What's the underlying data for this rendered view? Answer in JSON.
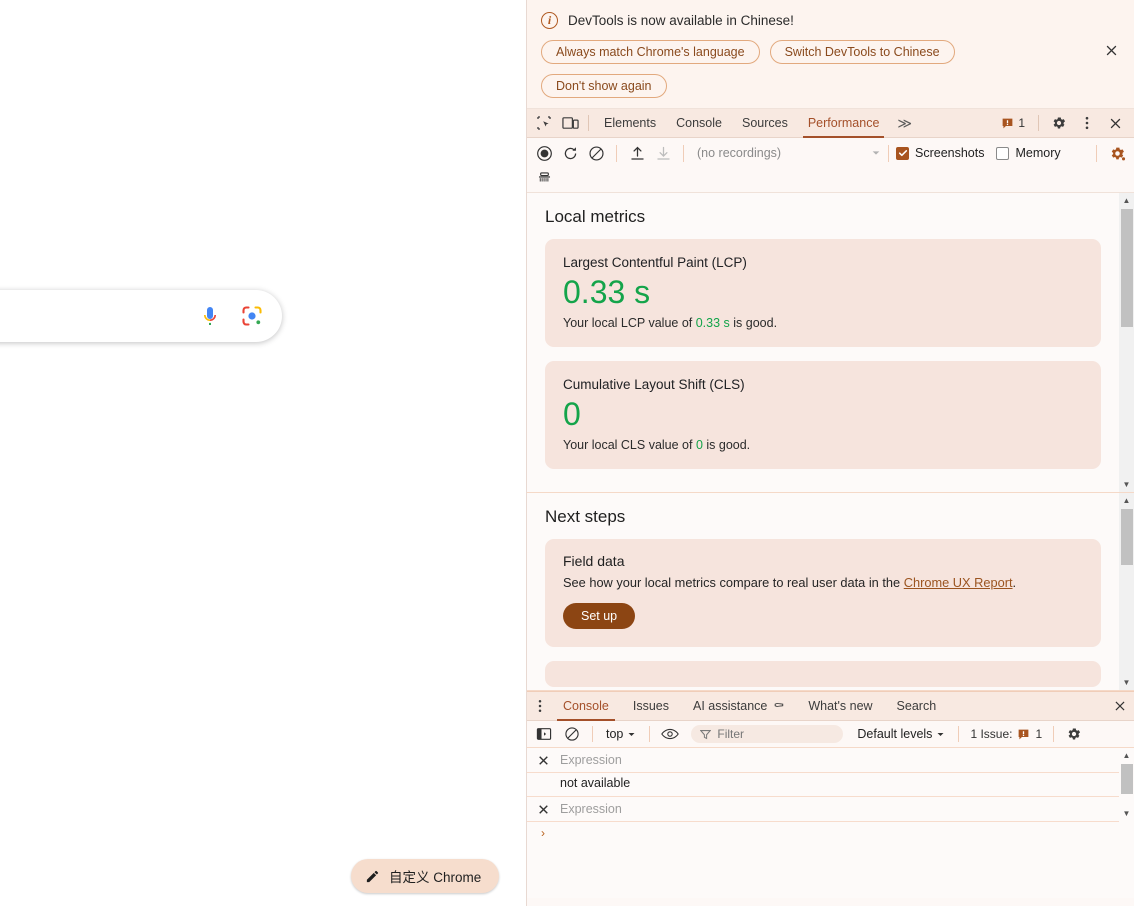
{
  "page": {
    "customize_button": "自定义 Chrome",
    "icons": {
      "pencil": "pencil-icon",
      "mic": "microphone-icon",
      "lens": "google-lens-icon"
    }
  },
  "devtools": {
    "infobar": {
      "message": "DevTools is now available in Chinese!",
      "buttons": [
        "Always match Chrome's language",
        "Switch DevTools to Chinese",
        "Don't show again"
      ],
      "close_label": "✕"
    },
    "tabstrip": {
      "tabs": [
        {
          "label": "Elements",
          "active": false
        },
        {
          "label": "Console",
          "active": false
        },
        {
          "label": "Sources",
          "active": false
        },
        {
          "label": "Performance",
          "active": true
        }
      ],
      "more_label": "≫",
      "issue_count": "1",
      "icons": {
        "inspect": "inspect-element-icon",
        "device": "device-toolbar-icon",
        "issues": "issues-badge-icon",
        "settings": "gear-icon",
        "more": "three-dots-vertical-icon",
        "close": "close-icon"
      }
    },
    "perf_toolbar": {
      "recordings_placeholder": "(no recordings)",
      "screenshots_label": "Screenshots",
      "screenshots_checked": true,
      "memory_label": "Memory",
      "memory_checked": false,
      "icons": {
        "record": "record-circle-icon",
        "reload": "reload-and-record-icon",
        "clear": "clear-icon",
        "upload": "import-profile-icon",
        "download": "export-profile-icon",
        "dropdown": "chevron-down-icon",
        "capture_settings": "capture-settings-gear-icon",
        "collect_garbage": "collect-garbage-icon"
      }
    },
    "local_metrics": {
      "title": "Local metrics",
      "cards": [
        {
          "name": "Largest Contentful Paint (LCP)",
          "value": "0.33 s",
          "desc_before": "Your local LCP value of ",
          "desc_value": "0.33 s",
          "desc_after": " is good."
        },
        {
          "name": "Cumulative Layout Shift (CLS)",
          "value": "0",
          "desc_before": "Your local CLS value of ",
          "desc_value": "0",
          "desc_after": " is good."
        }
      ]
    },
    "next_steps": {
      "title": "Next steps",
      "card": {
        "heading": "Field data",
        "text_before": "See how your local metrics compare to real user data in the ",
        "link": "Chrome UX Report",
        "text_after": ".",
        "button": "Set up"
      }
    },
    "drawer": {
      "tabs": [
        {
          "label": "Console",
          "active": true,
          "icon": ""
        },
        {
          "label": "Issues",
          "active": false,
          "icon": ""
        },
        {
          "label": "AI assistance",
          "active": false,
          "icon": "⚰"
        },
        {
          "label": "What's new",
          "active": false,
          "icon": ""
        },
        {
          "label": "Search",
          "active": false,
          "icon": ""
        }
      ],
      "close_label": "✕",
      "toolbar": {
        "context": "top",
        "filter_placeholder": "Filter",
        "levels": "Default levels",
        "issues_text": "1 Issue:",
        "issues_count": "1",
        "icons": {
          "sidebar": "console-sidebar-icon",
          "clear": "clear-console-icon",
          "eye": "live-expressions-eye-icon",
          "filter": "filter-funnel-icon",
          "settings": "gear-icon",
          "issues_badge": "issues-badge-icon"
        }
      },
      "live_expressions": [
        {
          "placeholder": "Expression",
          "result": "not available"
        },
        {
          "placeholder": "Expression",
          "result": null
        }
      ],
      "prompt": "›"
    },
    "colors": {
      "accent": "#a4502a",
      "good_green": "#14a44a",
      "card_bg": "#f6e4dd",
      "toolbar_bg": "#f8e9e1",
      "panel_bg": "#fdfaf9",
      "link": "#9b5420",
      "button_bg": "#8c4513",
      "checkbox_checked": "#a8541f"
    }
  }
}
